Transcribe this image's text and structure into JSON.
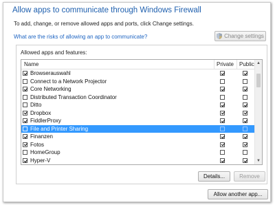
{
  "window": {
    "title": "Allow apps to communicate through Windows Firewall",
    "subtitle": "To add, change, or remove allowed apps and ports, click Change settings.",
    "risk_link": "What are the risks of allowing an app to communicate?",
    "change_settings_label": "Change settings"
  },
  "group": {
    "label": "Allowed apps and features:",
    "columns": {
      "name": "Name",
      "private": "Private",
      "public": "Public"
    },
    "rows": [
      {
        "name": "Browserauswahl",
        "enabled": true,
        "private": true,
        "public": true
      },
      {
        "name": "Connect to a Network Projector",
        "enabled": false,
        "private": false,
        "public": false
      },
      {
        "name": "Core Networking",
        "enabled": true,
        "private": true,
        "public": true
      },
      {
        "name": "Distributed Transaction Coordinator",
        "enabled": false,
        "private": false,
        "public": false
      },
      {
        "name": "Ditto",
        "enabled": false,
        "private": true,
        "public": true
      },
      {
        "name": "Dropbox",
        "enabled": true,
        "private": true,
        "public": true
      },
      {
        "name": "FiddlerProxy",
        "enabled": true,
        "private": true,
        "public": true
      },
      {
        "name": "File and Printer Sharing",
        "enabled": false,
        "private": false,
        "public": false,
        "selected": true
      },
      {
        "name": "Finanzen",
        "enabled": true,
        "private": true,
        "public": true
      },
      {
        "name": "Fotos",
        "enabled": true,
        "private": true,
        "public": true
      },
      {
        "name": "HomeGroup",
        "enabled": false,
        "private": false,
        "public": false
      },
      {
        "name": "Hyper-V",
        "enabled": true,
        "private": true,
        "public": true
      }
    ],
    "details_label": "Details...",
    "remove_label": "Remove"
  },
  "allow_another_label": "Allow another app...",
  "colors": {
    "title": "#1e5fae",
    "link": "#1d64c2",
    "selection": "#3399ff"
  },
  "icons": {
    "change_settings": "uac-shield-icon",
    "scroll_up": "scroll-up-arrow-icon",
    "scroll_down": "scroll-down-arrow-icon"
  }
}
